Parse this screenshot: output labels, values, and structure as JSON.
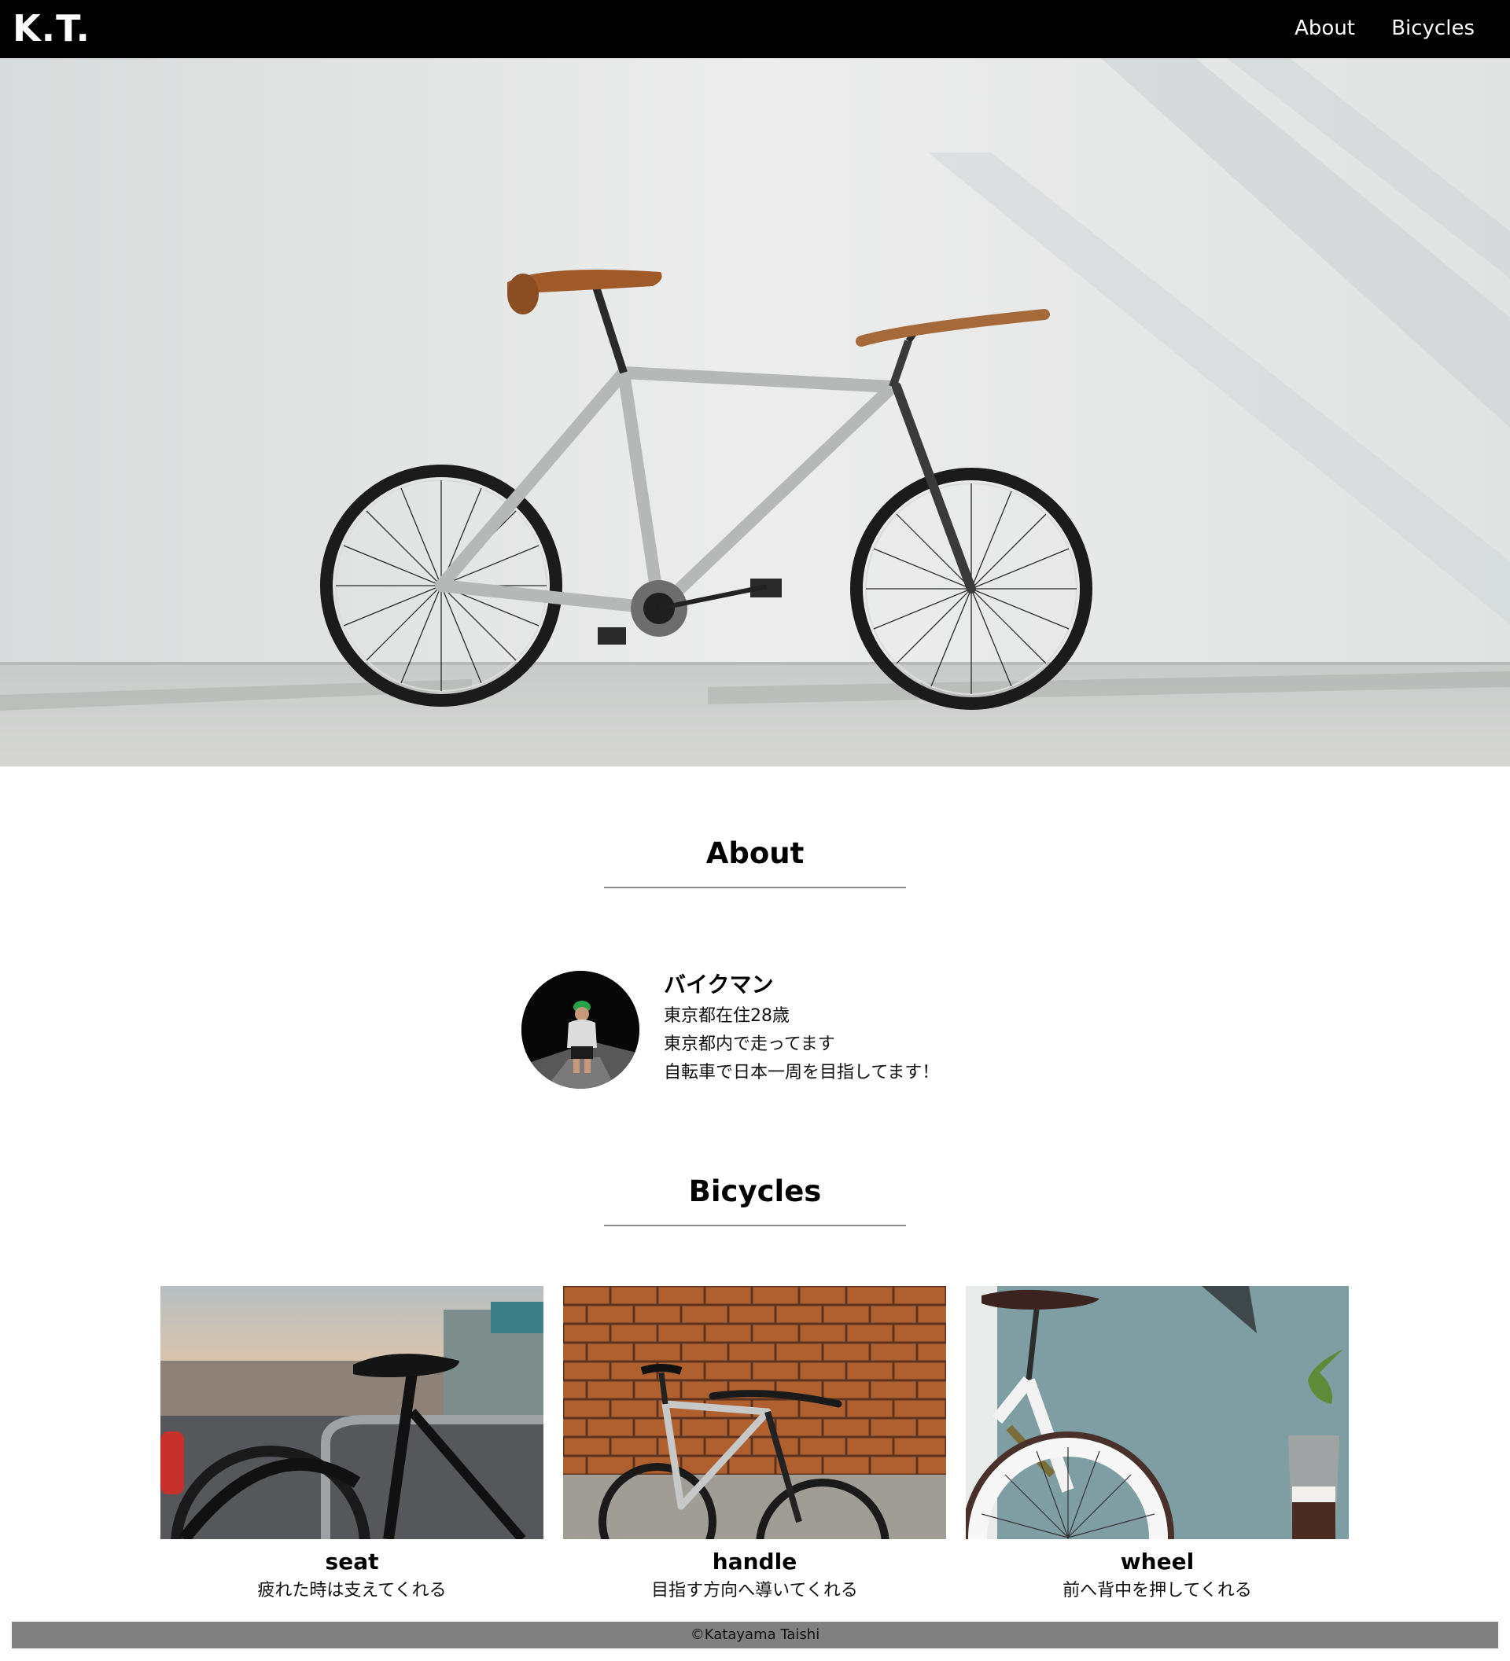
{
  "header": {
    "logo": "K.T.",
    "nav": [
      {
        "label": "About"
      },
      {
        "label": "Bicycles"
      }
    ]
  },
  "hero": {
    "image": "bicycle-leaning-on-white-wall-photo"
  },
  "about": {
    "title": "About",
    "avatar": "man-with-green-cap-photo",
    "name": "バイクマン",
    "lines": [
      "東京都在住28歳",
      "東京都内で走ってます",
      "自転車で日本一周を目指してます！"
    ]
  },
  "bicycles": {
    "title": "Bicycles",
    "items": [
      {
        "title": "seat",
        "text": "疲れた時は支えてくれる",
        "image": "bicycle-seat-photo"
      },
      {
        "title": "handle",
        "text": "目指す方向へ導いてくれる",
        "image": "bicycle-handle-brick-wall-photo"
      },
      {
        "title": "wheel",
        "text": "前へ背中を押してくれる",
        "image": "bicycle-white-wheel-photo"
      }
    ]
  },
  "footer": {
    "text": "©Katayama Taishi"
  }
}
